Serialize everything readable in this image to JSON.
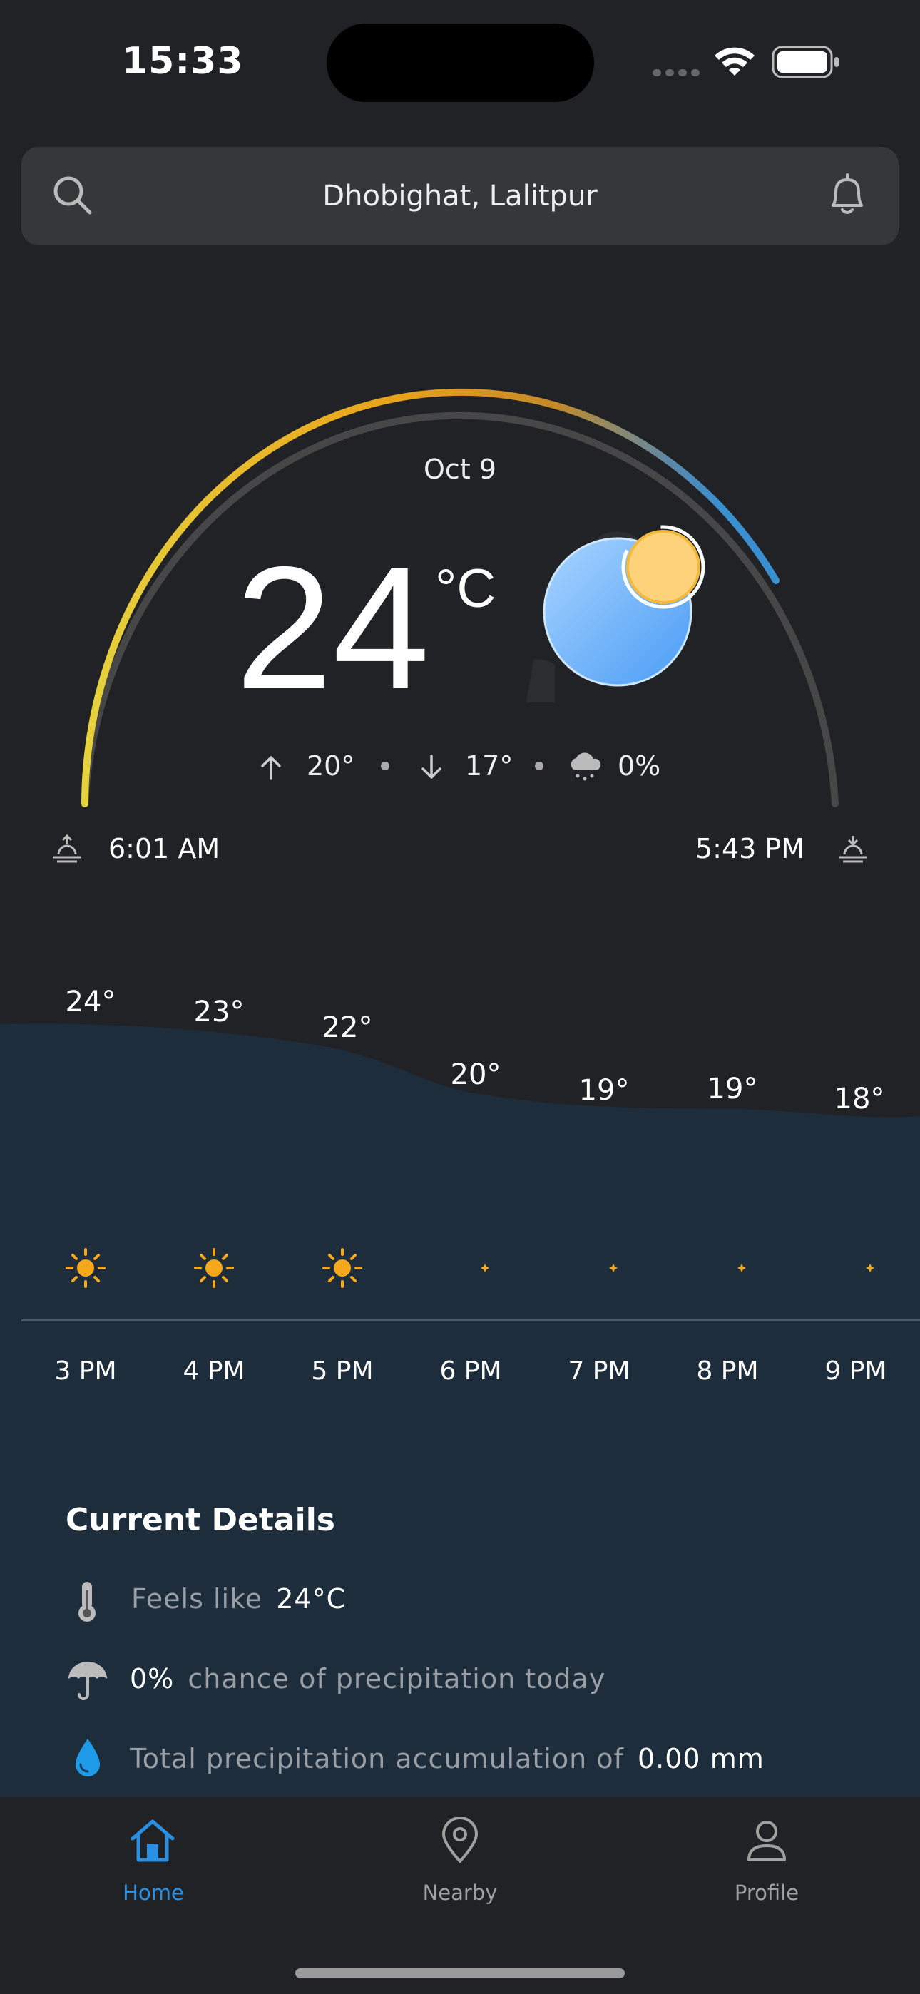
{
  "status": {
    "time": "15:33"
  },
  "search": {
    "location": "Dhobighat, Lalitpur"
  },
  "current": {
    "date": "Oct 9",
    "temp": "24",
    "unit": "°C",
    "high": "20°",
    "low": "17°",
    "precip": "0%",
    "sunrise": "6:01 AM",
    "sunset": "5:43 PM"
  },
  "hourly": [
    {
      "time": "3 PM",
      "temp": "24°",
      "icon": "sun-icon"
    },
    {
      "time": "4 PM",
      "temp": "23°",
      "icon": "sun-icon"
    },
    {
      "time": "5 PM",
      "temp": "22°",
      "icon": "sun-icon"
    },
    {
      "time": "6 PM",
      "temp": "20°",
      "icon": "moon-icon"
    },
    {
      "time": "7 PM",
      "temp": "19°",
      "icon": "moon-icon"
    },
    {
      "time": "8 PM",
      "temp": "19°",
      "icon": "moon-icon"
    },
    {
      "time": "9 PM",
      "temp": "18°",
      "icon": "moon-icon"
    }
  ],
  "details": {
    "title": "Current Details",
    "feels_label": "Feels like",
    "feels_value": "24°C",
    "precip_value": "0%",
    "precip_label": "chance of precipitation today",
    "accum_label": "Total precipitation accumulation of",
    "accum_value": "0.00 mm"
  },
  "tabs": [
    {
      "label": "Home",
      "icon": "home-icon",
      "active": true
    },
    {
      "label": "Nearby",
      "icon": "location-pin-icon",
      "active": false
    },
    {
      "label": "Profile",
      "icon": "user-icon",
      "active": false
    }
  ],
  "colors": {
    "accent": "#2a8fe0",
    "sun": "#f5a81c",
    "tab_inactive": "#a0a0a0"
  }
}
